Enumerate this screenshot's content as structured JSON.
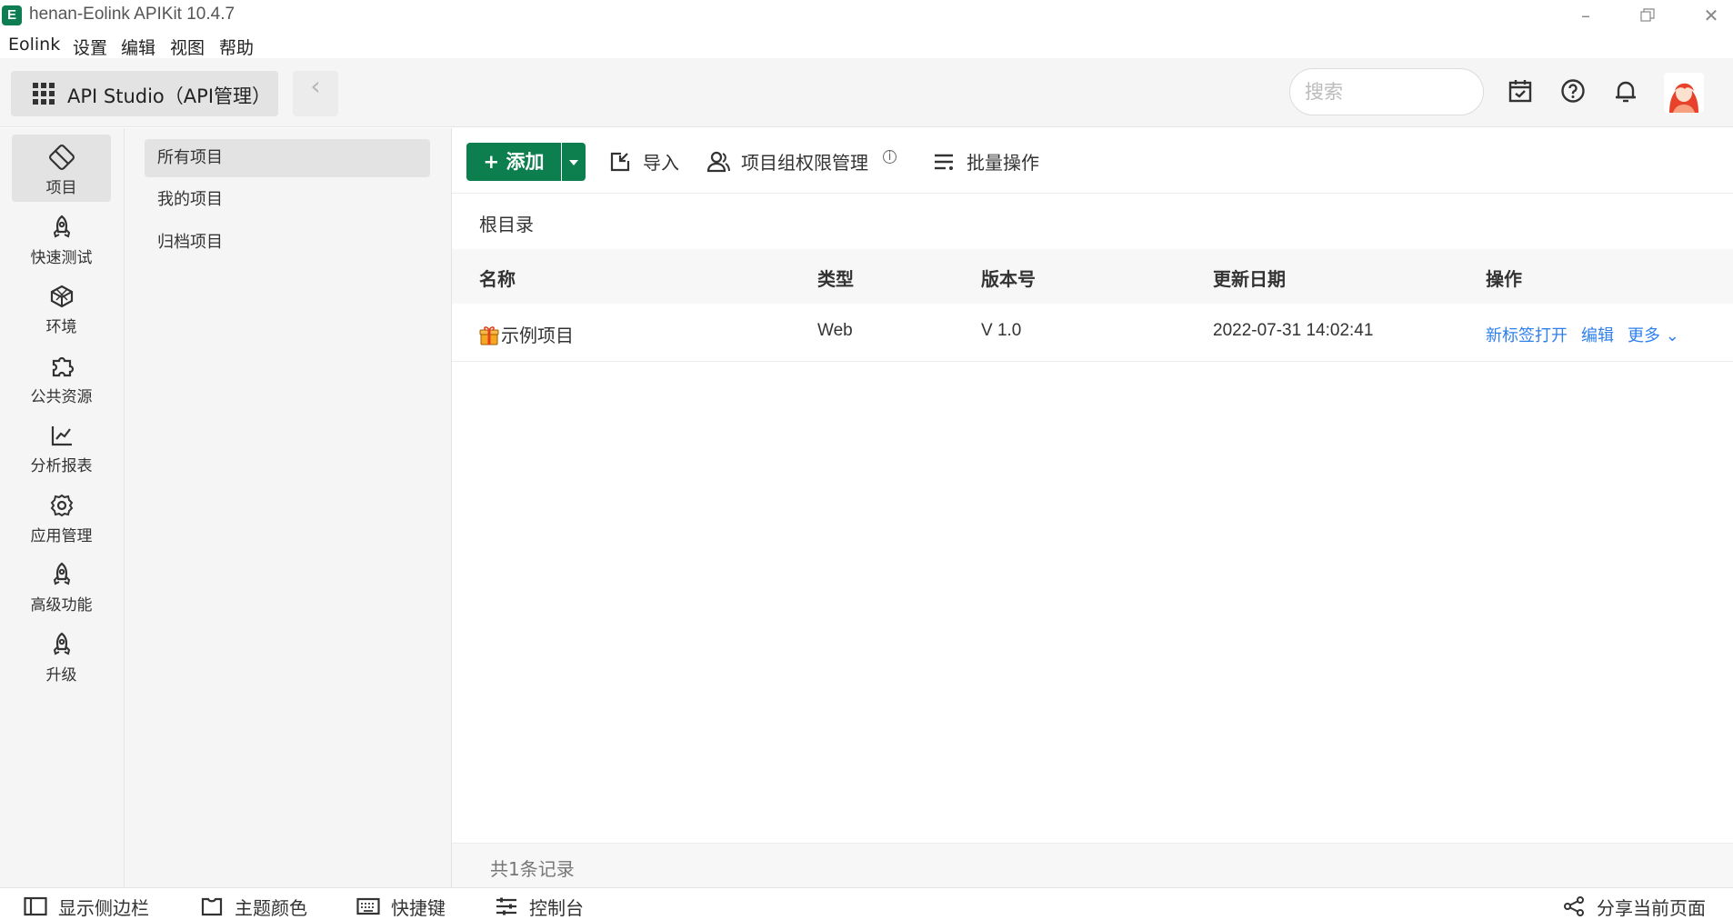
{
  "window": {
    "title": "henan-Eolink APIKit 10.4.7",
    "logo_text": "E",
    "controls": [
      "minimize-icon",
      "restore-icon",
      "close-icon"
    ]
  },
  "menu": [
    "Eolink",
    "设置",
    "编辑",
    "视图",
    "帮助"
  ],
  "header": {
    "studio_label": "API Studio（API管理）",
    "search_placeholder": "搜索",
    "icons": [
      "calendar-check-icon",
      "help-icon",
      "bell-icon",
      "avatar"
    ]
  },
  "rail": [
    {
      "label": "项目",
      "icon": "project-icon",
      "active": true
    },
    {
      "label": "快速测试",
      "icon": "rocket-icon"
    },
    {
      "label": "环境",
      "icon": "environment-icon"
    },
    {
      "label": "公共资源",
      "icon": "puzzle-icon"
    },
    {
      "label": "分析报表",
      "icon": "chart-icon"
    },
    {
      "label": "应用管理",
      "icon": "gear-icon"
    },
    {
      "label": "高级功能",
      "icon": "rocket-icon"
    },
    {
      "label": "升级",
      "icon": "rocket-icon"
    }
  ],
  "tree": [
    "所有项目",
    "我的项目",
    "归档项目"
  ],
  "toolbar": {
    "add_label": "+ 添加",
    "import_label": "导入",
    "perm_label": "项目组权限管理",
    "batch_label": "批量操作"
  },
  "breadcrumb": "根目录",
  "table": {
    "headers": [
      "名称",
      "类型",
      "版本号",
      "更新日期",
      "操作"
    ],
    "rows": [
      {
        "name": "示例项目",
        "type": "Web",
        "version": "V 1.0",
        "updated": "2022-07-31 14:02:41",
        "actions": {
          "open_tab": "新标签打开",
          "edit": "编辑",
          "more": "更多 ⌄"
        }
      }
    ]
  },
  "footer_count": "共1条记录",
  "statusbar": {
    "sidebar": "显示侧边栏",
    "theme": "主题颜色",
    "shortcuts": "快捷键",
    "console": "控制台",
    "share": "分享当前页面"
  },
  "colors": {
    "accent": "#0d7f4f",
    "link": "#2f80ed"
  }
}
